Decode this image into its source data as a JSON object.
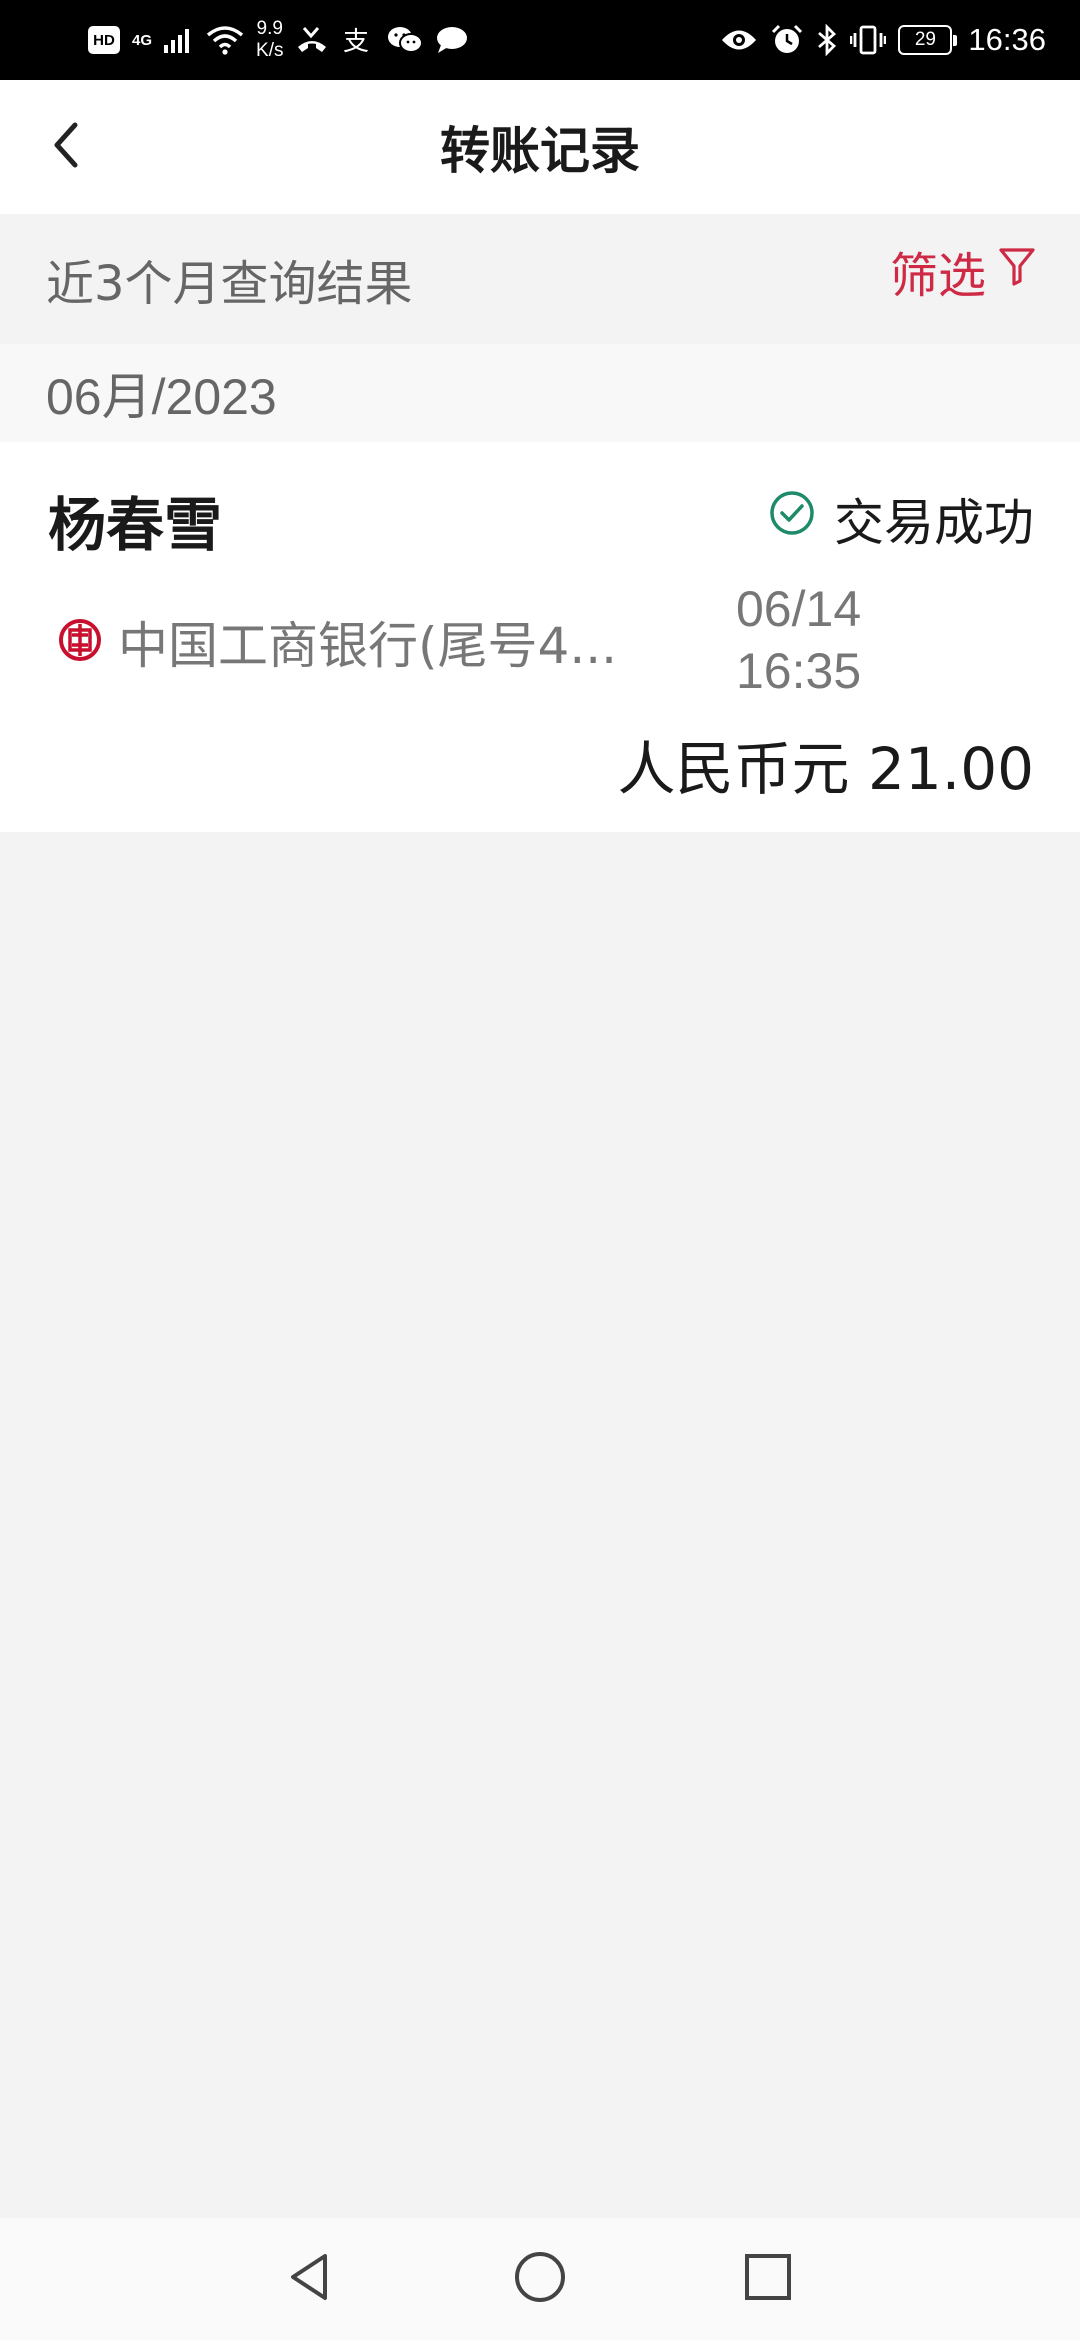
{
  "status_bar": {
    "hd": "HD",
    "network": "4G",
    "speed_value": "9.9",
    "speed_unit": "K/s",
    "battery": "29",
    "time": "16:36",
    "icons_left": [
      "missed-call-icon",
      "alipay-icon",
      "wechat-icon",
      "message-icon"
    ],
    "icons_right": [
      "eye-icon",
      "alarm-icon",
      "bluetooth-icon",
      "vibrate-icon"
    ]
  },
  "header": {
    "title": "转账记录"
  },
  "filter": {
    "query_label": "近3个月查询结果",
    "filter_label": "筛选",
    "accent_color": "#cf2a45"
  },
  "records": {
    "month": "06月/2023",
    "items": [
      {
        "name": "杨春雪",
        "status": "交易成功",
        "status_color": "#1f8a6a",
        "bank": "中国工商银行(尾号4...",
        "date": "06/14",
        "time": "16:35",
        "amount": "人民币元 21.00"
      }
    ]
  },
  "nav_bar": {
    "buttons": [
      "back-triangle-icon",
      "home-circle-icon",
      "recents-square-icon"
    ]
  }
}
